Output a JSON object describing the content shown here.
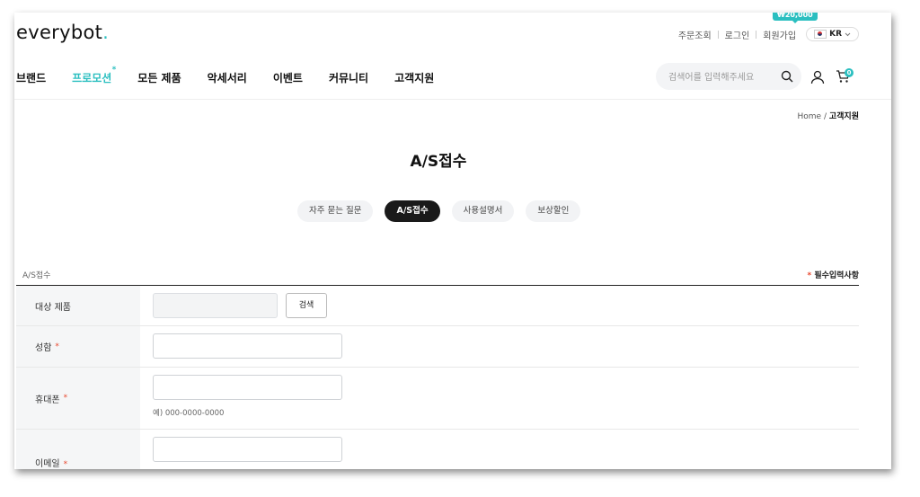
{
  "brand": {
    "logo_text": "everybot",
    "logo_dot": ".",
    "accent_color": "#2bbfc0"
  },
  "toplinks": {
    "order_check": "주문조회",
    "login": "로그인",
    "signup": "회원가입",
    "promo_badge": "₩20,000",
    "lang": "KR"
  },
  "nav": {
    "items": [
      "브랜드",
      "프로모션",
      "모든 제품",
      "악세서리",
      "이벤트",
      "커뮤니티",
      "고객지원"
    ],
    "active_marker": "*"
  },
  "search": {
    "placeholder": "검색어를 입력해주세요",
    "icon": "search-icon"
  },
  "header_icons": {
    "user": "user-icon",
    "cart": "cart-icon",
    "cart_count": "0"
  },
  "breadcrumb": {
    "home": "Home",
    "separator": "/",
    "current": "고객지원"
  },
  "page": {
    "title": "A/S접수"
  },
  "tabs": [
    {
      "label": "자주 묻는 질문",
      "active": false
    },
    {
      "label": "A/S접수",
      "active": true
    },
    {
      "label": "사용설명서",
      "active": false
    },
    {
      "label": "보상할인",
      "active": false
    }
  ],
  "form": {
    "section_title": "A/S접수",
    "required_note_star": "*",
    "required_note": "필수입력사항",
    "fields": [
      {
        "label": "대상 제품",
        "required": false,
        "button": "검색"
      },
      {
        "label": "성함",
        "required": true
      },
      {
        "label": "휴대폰",
        "required": true,
        "hint": "예) 000-0000-0000"
      },
      {
        "label": "이메일",
        "required": true
      }
    ],
    "required_star": "*"
  }
}
